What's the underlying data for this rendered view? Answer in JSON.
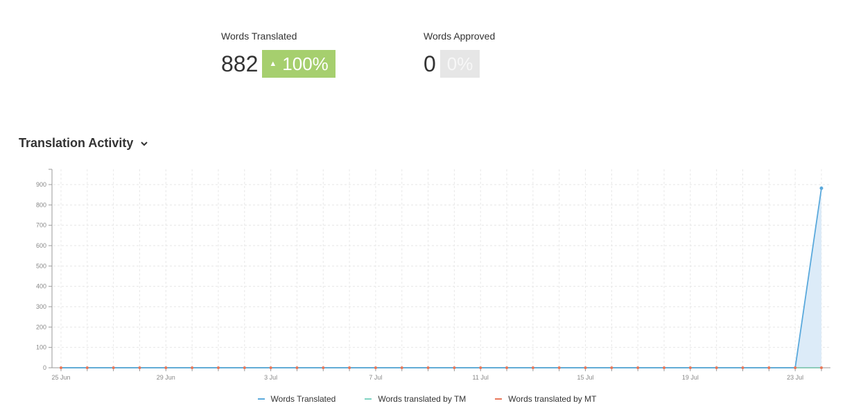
{
  "stats": {
    "translated": {
      "label": "Words Translated",
      "value": "882",
      "change": "100%",
      "arrow": "▲",
      "badge_color": "#a6cf6e"
    },
    "approved": {
      "label": "Words Approved",
      "value": "0",
      "change": "0%",
      "badge_color": "#e6e6e6"
    }
  },
  "section": {
    "title": "Translation Activity",
    "toggle_icon": "chevron-down-icon"
  },
  "chart_data": {
    "type": "line",
    "title": "Translation Activity",
    "xlabel": "",
    "ylabel": "",
    "ylim": [
      0,
      950
    ],
    "y_ticks": [
      0,
      100,
      200,
      300,
      400,
      500,
      600,
      700,
      800,
      900
    ],
    "x": [
      "25 Jun",
      "26 Jun",
      "27 Jun",
      "28 Jun",
      "29 Jun",
      "30 Jun",
      "1 Jul",
      "2 Jul",
      "3 Jul",
      "4 Jul",
      "5 Jul",
      "6 Jul",
      "7 Jul",
      "8 Jul",
      "9 Jul",
      "10 Jul",
      "11 Jul",
      "12 Jul",
      "13 Jul",
      "14 Jul",
      "15 Jul",
      "16 Jul",
      "17 Jul",
      "18 Jul",
      "19 Jul",
      "20 Jul",
      "21 Jul",
      "22 Jul",
      "23 Jul",
      "24 Jul"
    ],
    "x_tick_labels": [
      "25 Jun",
      "29 Jun",
      "3 Jul",
      "7 Jul",
      "11 Jul",
      "15 Jul",
      "19 Jul",
      "23 Jul"
    ],
    "grid": true,
    "legend_position": "bottom",
    "series": [
      {
        "name": "Words Translated",
        "color": "#5aa9dc",
        "fill": "#dcebf8",
        "values": [
          0,
          0,
          0,
          0,
          0,
          0,
          0,
          0,
          0,
          0,
          0,
          0,
          0,
          0,
          0,
          0,
          0,
          0,
          0,
          0,
          0,
          0,
          0,
          0,
          0,
          0,
          0,
          0,
          0,
          882
        ]
      },
      {
        "name": "Words translated by TM",
        "color": "#7fd3c2",
        "values": [
          0,
          0,
          0,
          0,
          0,
          0,
          0,
          0,
          0,
          0,
          0,
          0,
          0,
          0,
          0,
          0,
          0,
          0,
          0,
          0,
          0,
          0,
          0,
          0,
          0,
          0,
          0,
          0,
          0,
          0
        ]
      },
      {
        "name": "Words translated by MT",
        "color": "#e8785a",
        "values": [
          0,
          0,
          0,
          0,
          0,
          0,
          0,
          0,
          0,
          0,
          0,
          0,
          0,
          0,
          0,
          0,
          0,
          0,
          0,
          0,
          0,
          0,
          0,
          0,
          0,
          0,
          0,
          0,
          0,
          0
        ]
      }
    ]
  }
}
